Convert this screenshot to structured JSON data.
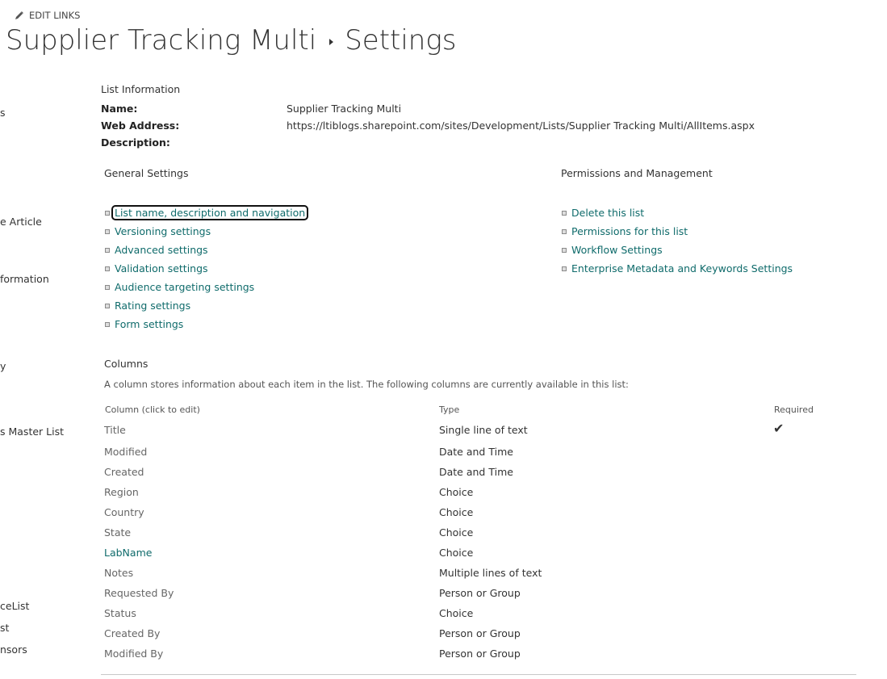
{
  "header": {
    "edit_links": "EDIT LINKS",
    "title": "Supplier Tracking Multi",
    "subtitle": "Settings"
  },
  "left_nav": [
    {
      "label": "s"
    },
    {
      "label": "e Article"
    },
    {
      "label": "formation"
    },
    {
      "label": "y"
    },
    {
      "label": "s Master List"
    },
    {
      "label": "ceList"
    },
    {
      "label": "st"
    },
    {
      "label": "nsors"
    }
  ],
  "list_info": {
    "heading": "List Information",
    "name_label": "Name:",
    "name_value": "Supplier Tracking Multi",
    "web_label": "Web Address:",
    "web_value": "https://ltiblogs.sharepoint.com/sites/Development/Lists/Supplier Tracking Multi/AllItems.aspx",
    "desc_label": "Description:",
    "desc_value": ""
  },
  "general_settings": {
    "heading": "General Settings",
    "links": [
      "List name, description and navigation",
      "Versioning settings",
      "Advanced settings",
      "Validation settings",
      "Audience targeting settings",
      "Rating settings",
      "Form settings"
    ]
  },
  "permissions": {
    "heading": "Permissions and Management",
    "links": [
      "Delete this list",
      "Permissions for this list",
      "Workflow Settings",
      "Enterprise Metadata and Keywords Settings"
    ]
  },
  "columns": {
    "heading": "Columns",
    "description": "A column stores information about each item in the list. The following columns are currently available in this list:",
    "header_name": "Column (click to edit)",
    "header_type": "Type",
    "header_required": "Required",
    "check_mark": "✔",
    "rows": [
      {
        "name": "Title",
        "type": "Single line of text",
        "required": true
      },
      {
        "name": "Modified",
        "type": "Date and Time",
        "required": false
      },
      {
        "name": "Created",
        "type": "Date and Time",
        "required": false
      },
      {
        "name": "Region",
        "type": "Choice",
        "required": false
      },
      {
        "name": "Country",
        "type": "Choice",
        "required": false
      },
      {
        "name": "State",
        "type": "Choice",
        "required": false
      },
      {
        "name": "LabName",
        "type": "Choice",
        "required": false
      },
      {
        "name": "Notes",
        "type": "Multiple lines of text",
        "required": false
      },
      {
        "name": "Requested By",
        "type": "Person or Group",
        "required": false
      },
      {
        "name": "Status",
        "type": "Choice",
        "required": false
      },
      {
        "name": "Created By",
        "type": "Person or Group",
        "required": false
      },
      {
        "name": "Modified By",
        "type": "Person or Group",
        "required": false
      }
    ]
  },
  "colors": {
    "link": "#0f6b6b",
    "text": "#333333"
  }
}
